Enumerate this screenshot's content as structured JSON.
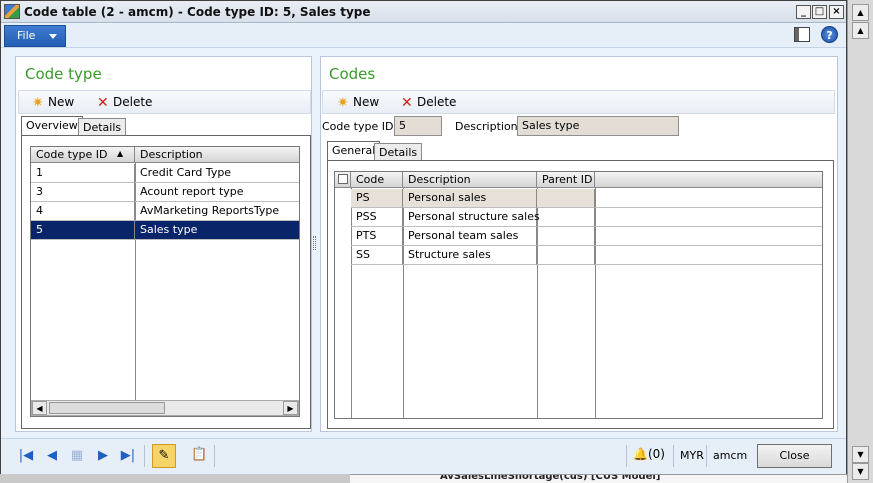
{
  "window": {
    "title": "Code table (2 - amcm) - Code type ID: 5, Sales type"
  },
  "menu": {
    "file_label": "File"
  },
  "left": {
    "title": "Code type",
    "new_label": "New",
    "delete_label": "Delete",
    "tabs": [
      "Overview",
      "Details"
    ],
    "columns": [
      "Code type ID",
      "Description"
    ],
    "rows": [
      [
        "1",
        "Credit Card Type"
      ],
      [
        "3",
        "Acount report type"
      ],
      [
        "4",
        "AvMarketing ReportsType"
      ],
      [
        "5",
        "Sales type"
      ]
    ],
    "selected_row": 3
  },
  "right": {
    "title": "Codes",
    "new_label": "New",
    "delete_label": "Delete",
    "code_type_id_label": "Code type ID:",
    "code_type_id_value": "5",
    "description_label": "Description:",
    "description_value": "Sales type",
    "tabs": [
      "General",
      "Details"
    ],
    "columns": [
      "Code",
      "Description",
      "Parent ID"
    ],
    "rows": [
      [
        "PS",
        "Personal sales",
        ""
      ],
      [
        "PSS",
        "Personal structure sales",
        ""
      ],
      [
        "PTS",
        "Personal team sales",
        ""
      ],
      [
        "SS",
        "Structure sales",
        ""
      ]
    ]
  },
  "status": {
    "notifications": "(0)",
    "currency": "MYR",
    "company": "amcm",
    "close_label": "Close"
  },
  "background": {
    "text": "AvSalesLineShortage(cus)  [CUS Model]"
  },
  "colors": {
    "accent": "#3a9a2a",
    "selection": "#0a246a",
    "file_button": "#2d68c3"
  }
}
